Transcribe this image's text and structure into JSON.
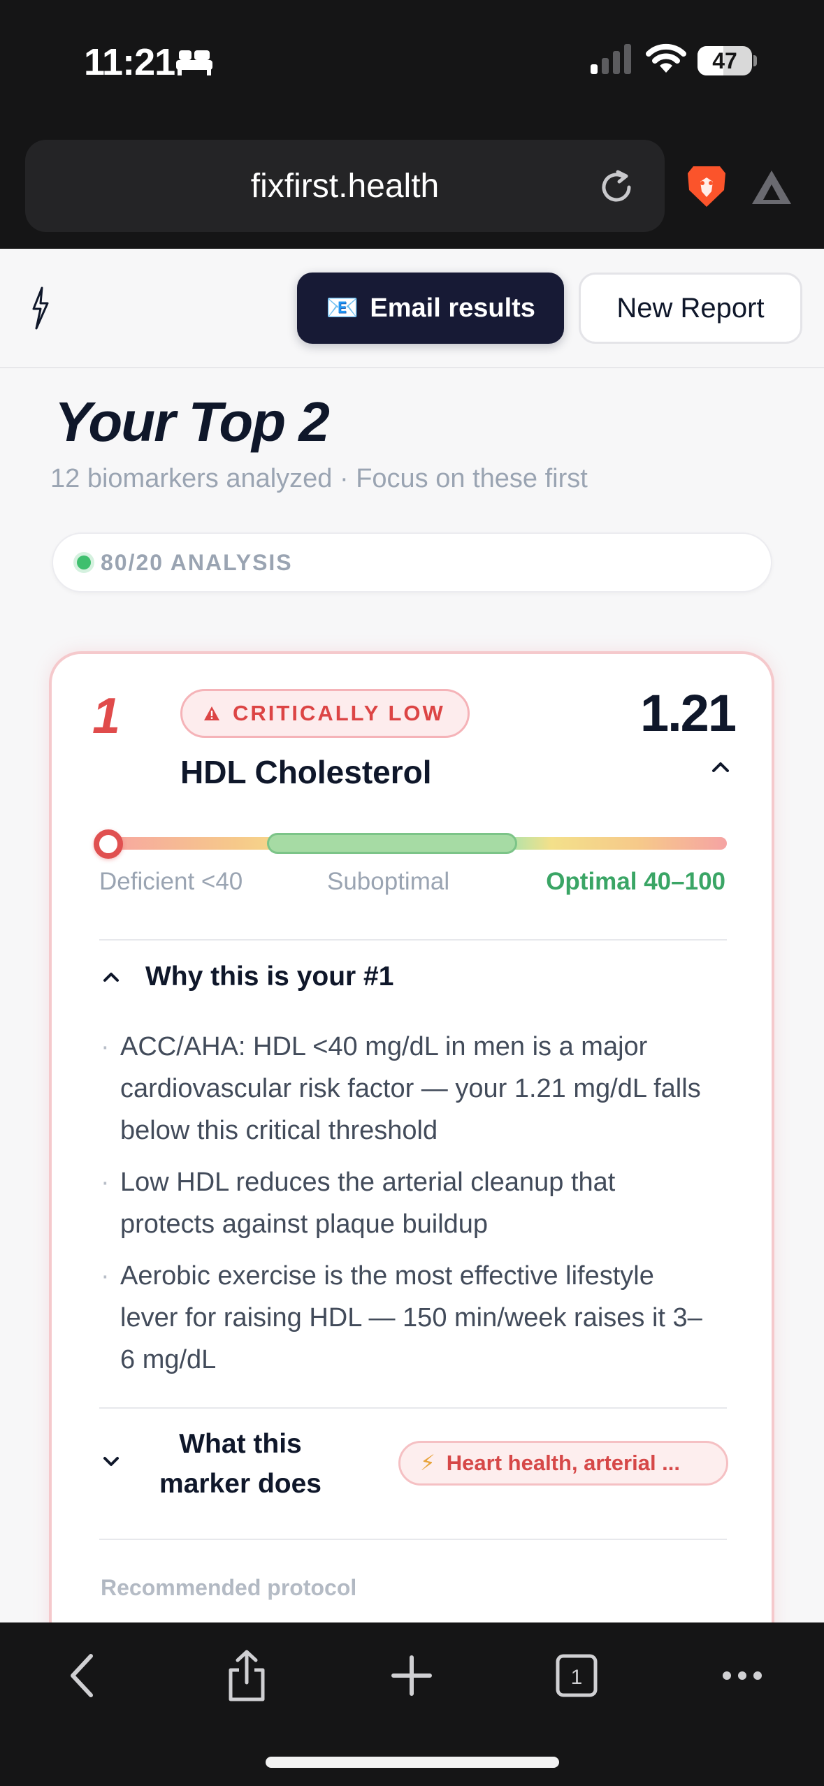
{
  "status_bar": {
    "time": "11:21",
    "battery": "47",
    "battery_level": 0.47
  },
  "browser": {
    "url": "fixfirst.health"
  },
  "header": {
    "email_icon": "📧",
    "email_label": "Email results",
    "new_report_label": "New Report"
  },
  "main": {
    "title": "Your Top 2",
    "subtitle": "12 biomarkers analyzed · Focus on these first",
    "analysis_label": "80/20 ANALYSIS"
  },
  "card": {
    "rank": "1",
    "status": "CRITICALLY LOW",
    "value": "1.21",
    "marker": "HDL Cholesterol",
    "range_labels": {
      "deficient": "Deficient <40",
      "suboptimal": "Suboptimal",
      "optimal": "Optimal 40–100"
    },
    "why_title": "Why this is your #1",
    "reasons": [
      "ACC/AHA: HDL <40 mg/dL in men is a major cardiovascular risk factor — your 1.21 mg/dL falls below this critical threshold",
      "Low HDL reduces the arterial cleanup that protects against plaque buildup",
      "Aerobic exercise is the most effective lifestyle lever for raising HDL — 150 min/week raises it 3–6 mg/dL"
    ],
    "what_title": "What this marker does",
    "organ_icon": "⚡",
    "organ_badge": "Heart health, arterial ...",
    "protocol_label": "Recommended protocol"
  },
  "toolbar": {
    "tab_count": "1"
  },
  "colors": {
    "accent_dark": "#171a35",
    "critical_red": "#dc4545",
    "optimal_green": "#3aa565",
    "muted_text": "#9aa4b2"
  },
  "icons": [
    "bed-icon",
    "signal-icon",
    "wifi-icon",
    "reload-icon",
    "brave-lion-icon",
    "brave-rewards-icon",
    "bolt-icon",
    "email-icon",
    "warning-icon",
    "chevron-up-icon",
    "chevron-down-icon",
    "back-icon",
    "share-icon",
    "plus-icon",
    "tabs-icon",
    "more-icon"
  ]
}
